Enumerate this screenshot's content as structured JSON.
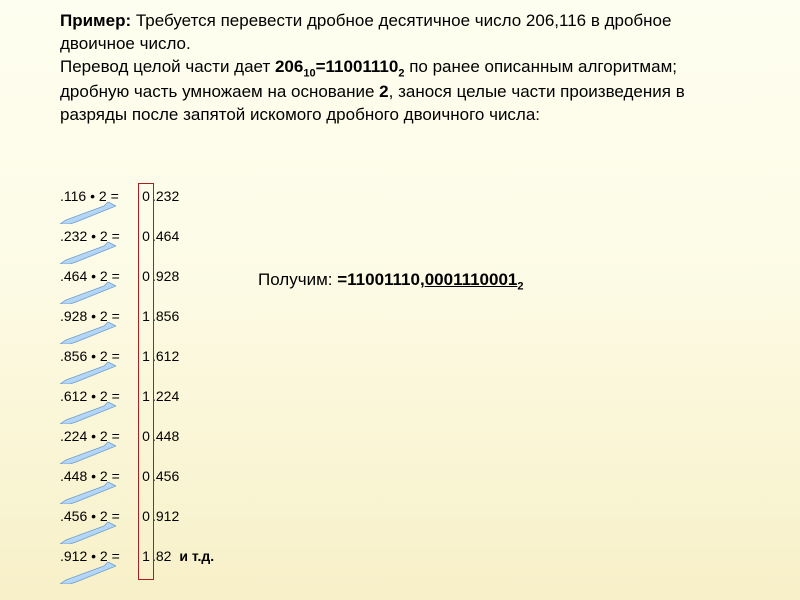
{
  "header": {
    "example_label": "Пример:",
    "task_text": " Требуется перевести дробное десятичное число 206,116 в дробное двоичное число.",
    "line2_a": "Перевод целой части дает ",
    "conv_lhs": "206",
    "conv_lhs_sub": "10",
    "conv_eq": "=11001110",
    "conv_rhs_sub": "2",
    "line2_b": " по ранее описанным алгоритмам; дробную часть умножаем на основание ",
    "base": "2",
    "line2_c": ", занося целые части произведения в разряды после запятой искомого дробного двоичного числа:"
  },
  "calc": [
    {
      "lhs": ".116 • 2 = ",
      "digit": "0",
      "rhs": ".232"
    },
    {
      "lhs": ".232 • 2 = ",
      "digit": "0",
      "rhs": ".464"
    },
    {
      "lhs": ".464 • 2 = ",
      "digit": "0",
      "rhs": ".928"
    },
    {
      "lhs": ".928 • 2 = ",
      "digit": "1",
      "rhs": ".856"
    },
    {
      "lhs": ".856 • 2 = ",
      "digit": "1",
      "rhs": ".612"
    },
    {
      "lhs": ".612 • 2 = ",
      "digit": "1",
      "rhs": ".224"
    },
    {
      "lhs": ".224 • 2 = ",
      "digit": "0",
      "rhs": ".448"
    },
    {
      "lhs": ".448 • 2 = ",
      "digit": "0",
      "rhs": ".456"
    },
    {
      "lhs": ".456 • 2 = ",
      "digit": "0",
      "rhs": ".912"
    },
    {
      "lhs": ".912 • 2 = ",
      "digit": "1",
      "rhs": ".82"
    }
  ],
  "etc": "и т.д.",
  "result": {
    "prefix": "Получим: ",
    "eq": "=11001110,",
    "frac": "0001110001",
    "sub": "2"
  }
}
